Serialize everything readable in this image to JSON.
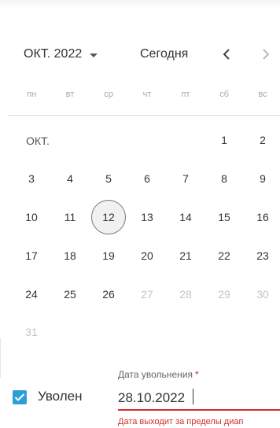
{
  "header": {
    "month_year": "ОКТ. 2022",
    "today_label": "Сегодня"
  },
  "weekdays": [
    "пн",
    "вт",
    "ср",
    "чт",
    "пт",
    "сб",
    "вс"
  ],
  "month_label": "ОКТ.",
  "days": [
    {
      "d": "1",
      "col": 5,
      "row": 0,
      "muted": false
    },
    {
      "d": "2",
      "col": 6,
      "row": 0,
      "muted": false
    },
    {
      "d": "3",
      "col": 0,
      "row": 1,
      "muted": false
    },
    {
      "d": "4",
      "col": 1,
      "row": 1,
      "muted": false
    },
    {
      "d": "5",
      "col": 2,
      "row": 1,
      "muted": false
    },
    {
      "d": "6",
      "col": 3,
      "row": 1,
      "muted": false
    },
    {
      "d": "7",
      "col": 4,
      "row": 1,
      "muted": false
    },
    {
      "d": "8",
      "col": 5,
      "row": 1,
      "muted": false
    },
    {
      "d": "9",
      "col": 6,
      "row": 1,
      "muted": false
    },
    {
      "d": "10",
      "col": 0,
      "row": 2,
      "muted": false
    },
    {
      "d": "11",
      "col": 1,
      "row": 2,
      "muted": false
    },
    {
      "d": "12",
      "col": 2,
      "row": 2,
      "muted": false,
      "selected": true
    },
    {
      "d": "13",
      "col": 3,
      "row": 2,
      "muted": false
    },
    {
      "d": "14",
      "col": 4,
      "row": 2,
      "muted": false
    },
    {
      "d": "15",
      "col": 5,
      "row": 2,
      "muted": false
    },
    {
      "d": "16",
      "col": 6,
      "row": 2,
      "muted": false
    },
    {
      "d": "17",
      "col": 0,
      "row": 3,
      "muted": false
    },
    {
      "d": "18",
      "col": 1,
      "row": 3,
      "muted": false
    },
    {
      "d": "19",
      "col": 2,
      "row": 3,
      "muted": false
    },
    {
      "d": "20",
      "col": 3,
      "row": 3,
      "muted": false
    },
    {
      "d": "21",
      "col": 4,
      "row": 3,
      "muted": false
    },
    {
      "d": "22",
      "col": 5,
      "row": 3,
      "muted": false
    },
    {
      "d": "23",
      "col": 6,
      "row": 3,
      "muted": false
    },
    {
      "d": "24",
      "col": 0,
      "row": 4,
      "muted": false
    },
    {
      "d": "25",
      "col": 1,
      "row": 4,
      "muted": false
    },
    {
      "d": "26",
      "col": 2,
      "row": 4,
      "muted": false
    },
    {
      "d": "27",
      "col": 3,
      "row": 4,
      "muted": true
    },
    {
      "d": "28",
      "col": 4,
      "row": 4,
      "muted": true
    },
    {
      "d": "29",
      "col": 5,
      "row": 4,
      "muted": true
    },
    {
      "d": "30",
      "col": 6,
      "row": 4,
      "muted": true
    },
    {
      "d": "31",
      "col": 0,
      "row": 5,
      "muted": true
    }
  ],
  "form": {
    "checkbox_label": "Уволен",
    "checkbox_checked": true,
    "field_label": "Дата увольнения",
    "required_mark": "*",
    "date_value": "28.10.2022",
    "error_text": "Дата выходит за пределы диап"
  },
  "colors": {
    "accent": "#2d9fd8",
    "error": "#d32f2f"
  }
}
